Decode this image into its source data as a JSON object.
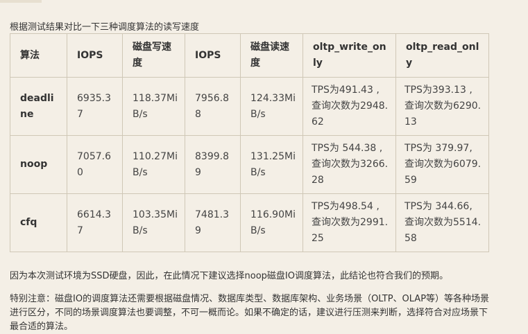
{
  "intro": "根据测试结果对比一下三种调度算法的读写速度",
  "table": {
    "headers": [
      "算法",
      "IOPS",
      "磁盘写速度",
      "IOPS",
      "磁盘读速度",
      "oltp_write_only",
      "oltp_read_only"
    ],
    "rows": [
      [
        "deadline",
        "6935.37",
        "118.37MiB/s",
        "7956.88",
        "124.33MiB/s",
        "TPS为491.43 ,查询次数为2948.62",
        "TPS为393.13 ,查询次数为6290.13"
      ],
      [
        "noop",
        "7057.60",
        "110.27MiB/s",
        "8399.89",
        "131.25MiB/s",
        "TPS为 544.38 ,查询次数为3266.28",
        "TPS为 379.97,查询次数为6079.59"
      ],
      [
        "cfq",
        "6614.37",
        "103.35MiB/s",
        "7481.39",
        "116.90MiB/s",
        "TPS为498.54 ,查询次数为2991.25",
        "TPS为 344.66,查询次数为5514.58"
      ]
    ]
  },
  "conclusion": "因为本次测试环境为SSD硬盘，因此，在此情况下建议选择noop磁盘IO调度算法，此结论也符合我们的预期。",
  "special_note": "特别注意：磁盘IO的调度算法还需要根据磁盘情况、数据库类型、数据库架构、业务场景（OLTP、OLAP等）等各种场景进行区分，不同的场景调度算法也要调整，不可一概而论。如果不确定的话，建议进行压测来判断，选择符合对应场景下最合适的算法。"
}
